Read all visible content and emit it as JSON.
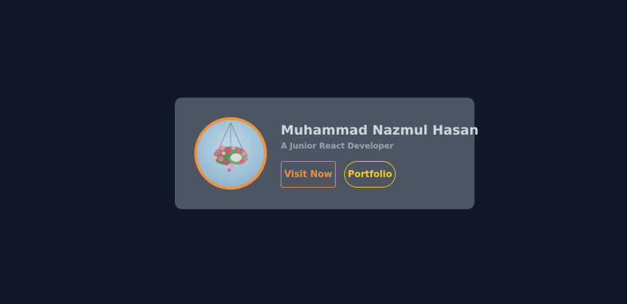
{
  "profile": {
    "name": "Muhammad Nazmul Hasan",
    "title": "A Junior React Developer",
    "avatar_icon": "hanging-flower-basket-photo"
  },
  "actions": {
    "visit_label": "Visit Now",
    "portfolio_label": "Portfolio"
  },
  "colors": {
    "background": "#111827",
    "card": "#4b5563",
    "accent_orange": "#f0923a",
    "accent_yellow": "#facc15",
    "name_text": "#d1d5db",
    "subtitle_text": "#9ca3af"
  }
}
